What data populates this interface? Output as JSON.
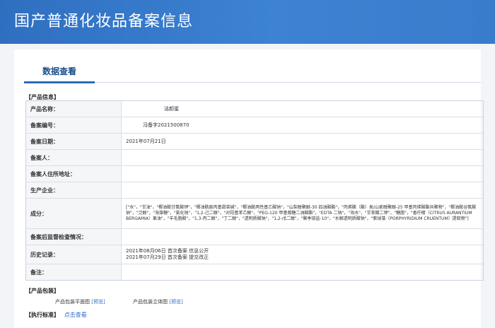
{
  "header": {
    "title": "国产普通化妆品备案信息"
  },
  "tab": {
    "label": "数据查看"
  },
  "product_info": {
    "section_title": "【产品信息】",
    "rows": [
      {
        "label": "产品名称：",
        "value": "洁颜蜜"
      },
      {
        "label": "备案编号：",
        "value": "冯备字2021500870"
      },
      {
        "label": "备案日期：",
        "value": "2021年07月21日"
      },
      {
        "label": "备案人：",
        "value": ""
      },
      {
        "label": "备案人住所地址：",
        "value": ""
      },
      {
        "label": "生产企业：",
        "value": ""
      },
      {
        "label": "成分：",
        "value": "[\"水\"，\"甘油\"，\"椰油酰甘氨酸钾\"，\"椰油酰胺丙基甜菜碱\"，\"椰油酰两性基乙酸钠\"，\"山梨醇聚醚-30 四油酸酯\"，\"丙烯酸（酯）类/山嵛醇聚醚-25 甲基丙烯酸酯共聚物\"，\"椰油酰谷氨酸钠\"，\"泛醇\"，\"海藻糖\"，\"氯化钠\"，\"1,2-己二醇\"，\"对羟基苯乙酮\"，\"PEG-120 甲基葡糖二油酸酯\"，\"EDTA 二钠\"，\"海水\"，\"甘草酸二钾\"，\"糖脂\"，\"香柠檬（CITRUS AURANTIUM BERGAMIA）果油\"，\"羊毛脂酸\"，\"1,3-丙二醇\"，\"丁二醇\"，\"透明质酸钠\"，\"1,2-戊二醇\"，\"聚季铵盐-10\"，\"水解透明质酸钠\"，\"紫球藻（PORPHYRIDIUM CRUENTUM）提取物\"]"
      },
      {
        "label": "备案后监督检查情况：",
        "value": ""
      },
      {
        "label": "历史记录：",
        "value": "2021年08月06日 首次备案 信息公开",
        "value2": "2021年07月29日 首次备案 提交改正"
      },
      {
        "label": "备注：",
        "value": ""
      }
    ]
  },
  "packaging": {
    "section_title": "【产品包装】",
    "flat_label": "产品包装平面图",
    "flat_link": "[预览]",
    "solid_label": "产品包装立体图",
    "solid_link": "[预览]"
  },
  "standard": {
    "section_title": "【执行标准】",
    "link": "点击查看"
  }
}
